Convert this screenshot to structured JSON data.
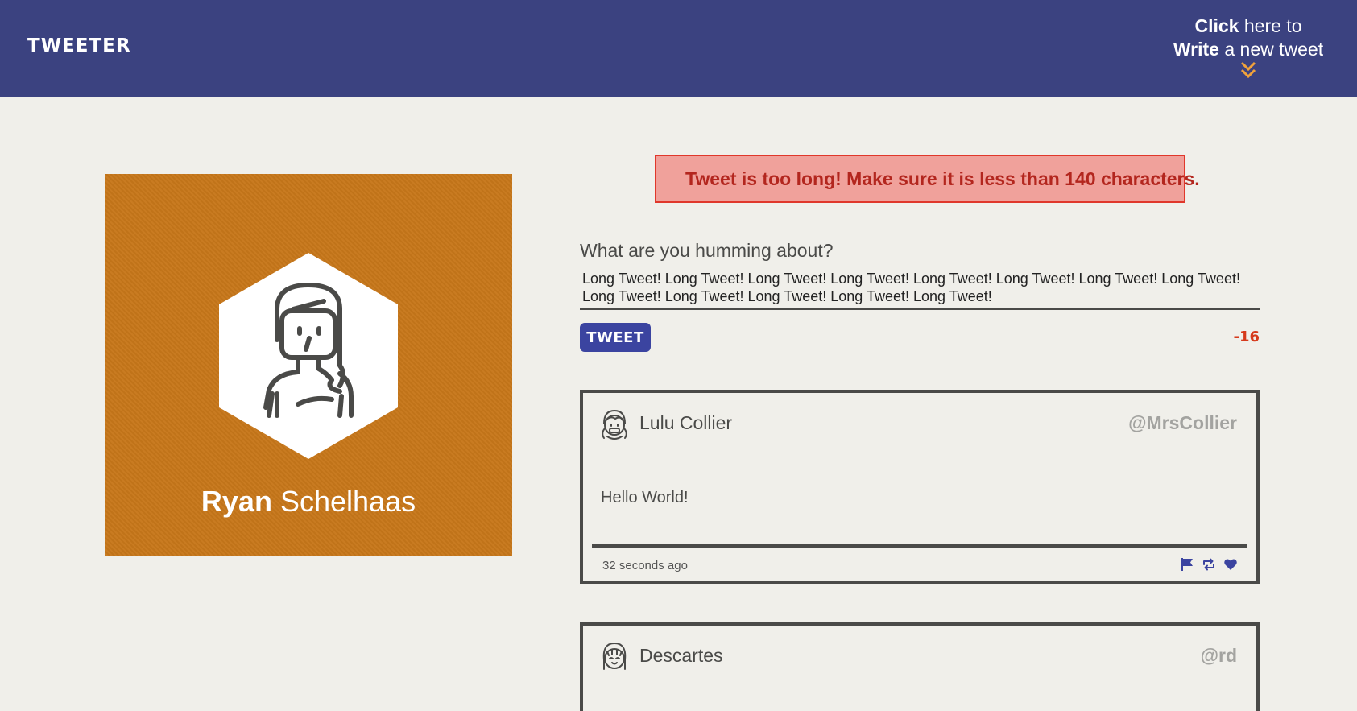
{
  "nav": {
    "logo": "TWEETER",
    "compose_toggle": {
      "line1_bold": "Click",
      "line1_rest": " here to",
      "line2_bold": "Write",
      "line2_rest": " a new tweet",
      "icon": "double-chevron-down-icon"
    }
  },
  "profile": {
    "first_name": "Ryan",
    "last_name": "Schelhaas",
    "avatar_icon": "woman-avatar-icon",
    "background_color": "#c7771a"
  },
  "error": {
    "icon": "close-x-icon",
    "message": "Tweet is too long! Make sure it is less than 140 characters."
  },
  "compose": {
    "label": "What are you humming about?",
    "text": "Long Tweet! Long Tweet! Long Tweet! Long Tweet! Long Tweet! Long Tweet! Long Tweet! Long Tweet! Long Tweet! Long Tweet! Long Tweet! Long Tweet! Long Tweet!",
    "button_label": "TWEET",
    "counter": "-16"
  },
  "tweets": [
    {
      "name": "Lulu Collier",
      "handle": "@MrsCollier",
      "body": "Hello World!",
      "time": "32 seconds ago",
      "avatar_icon": "girl-avatar-icon",
      "actions": [
        "flag-icon",
        "retweet-icon",
        "heart-icon"
      ]
    },
    {
      "name": "Descartes",
      "handle": "@rd",
      "avatar_icon": "girl-avatar-icon"
    }
  ],
  "colors": {
    "nav": "#3b4280",
    "accent": "#f0a23b",
    "error_bg": "#f0a19b",
    "error_text": "#b3261e",
    "button": "#3b44a0",
    "counter": "#d63a1c"
  }
}
